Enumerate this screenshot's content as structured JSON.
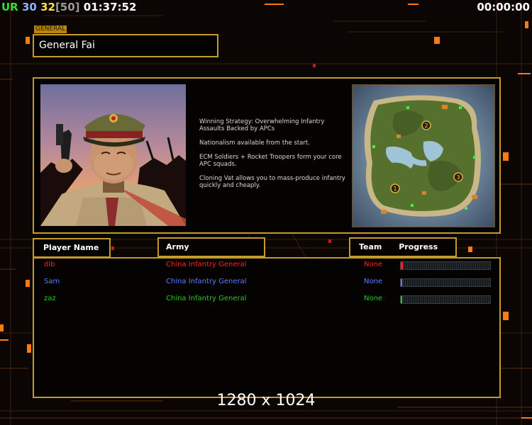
{
  "hud": {
    "ur_label": "UR",
    "value_a": "30",
    "value_b": "32",
    "value_c": "[50]",
    "game_time": "01:37:52",
    "timer": "00:00:00"
  },
  "general": {
    "tag": "GENERAL",
    "name": "General Fai"
  },
  "description": [
    "Winning Strategy: Overwhelming Infantry Assaults Backed by APCs",
    "Nationalism available from the start.",
    "ECM Soldiers + Rocket Troopers form your core APC squads.",
    "Cloning Vat allows you to mass-produce infantry quickly and cheaply."
  ],
  "map": {
    "markers": [
      "1",
      "2",
      "3"
    ]
  },
  "headers": {
    "player_name": "Player Name",
    "army": "Army",
    "team": "Team",
    "progress": "Progress"
  },
  "players": [
    {
      "name": "dib",
      "army": "China Infantry General",
      "team": "None",
      "color": "#ff2020",
      "progress": 0.02
    },
    {
      "name": "Sam",
      "army": "China Infantry General",
      "team": "None",
      "color": "#5a7cff",
      "progress": 0.01
    },
    {
      "name": "zaz",
      "army": "China Infantry General",
      "team": "None",
      "color": "#22cc22",
      "progress": 0.0
    }
  ],
  "colors": {
    "accent": "#c49a2a",
    "ur": "#33dd33",
    "value_a": "#8fb4ff",
    "value_b": "#ffe14a",
    "value_c": "#9a9a9a"
  },
  "resolution": "1280 x 1024"
}
